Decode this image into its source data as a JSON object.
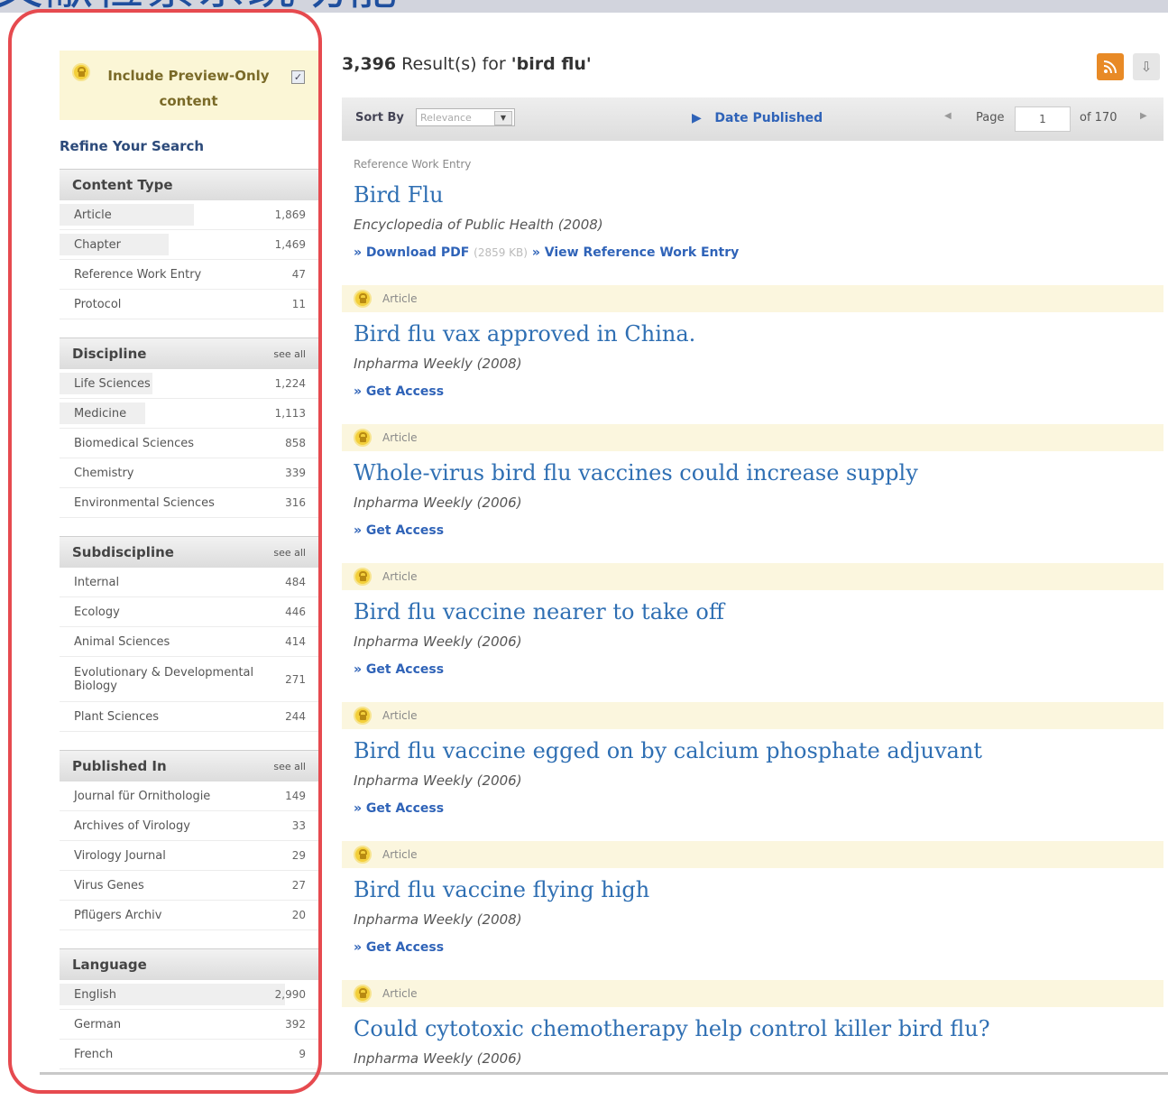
{
  "page_heading": "文献检索系统功能",
  "sidebar": {
    "preview_label": "Include Preview-Only content",
    "preview_checked": true,
    "refine_title": "Refine Your Search",
    "facets": [
      {
        "title": "Content Type",
        "see_all": "",
        "items": [
          {
            "label": "Article",
            "count": "1,869",
            "share": 0.52
          },
          {
            "label": "Chapter",
            "count": "1,469",
            "share": 0.42
          },
          {
            "label": "Reference Work Entry",
            "count": "47",
            "share": 0.0
          },
          {
            "label": "Protocol",
            "count": "11",
            "share": 0.0
          }
        ]
      },
      {
        "title": "Discipline",
        "see_all": "see all",
        "items": [
          {
            "label": "Life Sciences",
            "count": "1,224",
            "share": 0.36
          },
          {
            "label": "Medicine",
            "count": "1,113",
            "share": 0.33
          },
          {
            "label": "Biomedical Sciences",
            "count": "858",
            "share": 0.0
          },
          {
            "label": "Chemistry",
            "count": "339",
            "share": 0.0
          },
          {
            "label": "Environmental Sciences",
            "count": "316",
            "share": 0.0
          }
        ]
      },
      {
        "title": "Subdiscipline",
        "see_all": "see all",
        "items": [
          {
            "label": "Internal",
            "count": "484",
            "share": 0.0
          },
          {
            "label": "Ecology",
            "count": "446",
            "share": 0.0
          },
          {
            "label": "Animal Sciences",
            "count": "414",
            "share": 0.0
          },
          {
            "label": "Evolutionary & Developmental Biology",
            "count": "271",
            "share": 0.0,
            "tall": true
          },
          {
            "label": "Plant Sciences",
            "count": "244",
            "share": 0.0
          }
        ]
      },
      {
        "title": "Published In",
        "see_all": "see all",
        "items": [
          {
            "label": "Journal für Ornithologie",
            "count": "149",
            "share": 0.0
          },
          {
            "label": "Archives of Virology",
            "count": "33",
            "share": 0.0
          },
          {
            "label": "Virology Journal",
            "count": "29",
            "share": 0.0
          },
          {
            "label": "Virus Genes",
            "count": "27",
            "share": 0.0
          },
          {
            "label": "Pflügers Archiv",
            "count": "20",
            "share": 0.0
          }
        ]
      },
      {
        "title": "Language",
        "see_all": "",
        "items": [
          {
            "label": "English",
            "count": "2,990",
            "share": 0.87
          },
          {
            "label": "German",
            "count": "392",
            "share": 0.0
          },
          {
            "label": "French",
            "count": "9",
            "share": 0.0
          }
        ]
      }
    ]
  },
  "results_header": {
    "count": "3,396",
    "text_before_query": " Result(s) for ",
    "query": "'bird flu'",
    "rss_icon": "rss-icon",
    "download_icon": "download-icon"
  },
  "toolbar": {
    "sort_by_label": "Sort By",
    "sort_value": "Relevance",
    "date_published": "Date Published",
    "page_label": "Page",
    "page_value": "1",
    "page_of": "of 170",
    "prev_icon": "◀",
    "next_icon": "▶"
  },
  "results": [
    {
      "type": "Reference Work Entry",
      "locked": false,
      "title": "Bird Flu",
      "source": "Encyclopedia of Public Health (2008)",
      "link1": "» Download PDF",
      "size": "(2859 KB)",
      "link2": "» View Reference Work Entry"
    },
    {
      "type": "Article",
      "locked": true,
      "title": "Bird flu vax approved in China.",
      "source": "Inpharma Weekly (2008)",
      "link1": "» Get Access"
    },
    {
      "type": "Article",
      "locked": true,
      "title": "Whole-virus bird flu vaccines could increase supply",
      "source": "Inpharma Weekly (2006)",
      "link1": "» Get Access"
    },
    {
      "type": "Article",
      "locked": true,
      "title": "Bird flu vaccine nearer to take off",
      "source": "Inpharma Weekly (2006)",
      "link1": "» Get Access"
    },
    {
      "type": "Article",
      "locked": true,
      "title": "Bird flu vaccine egged on by calcium phosphate adjuvant",
      "source": "Inpharma Weekly (2006)",
      "link1": "» Get Access"
    },
    {
      "type": "Article",
      "locked": true,
      "title": "Bird flu vaccine flying high",
      "source": "Inpharma Weekly (2008)",
      "link1": "» Get Access"
    },
    {
      "type": "Article",
      "locked": true,
      "title": "Could cytotoxic chemotherapy help control killer bird flu?",
      "source": "Inpharma Weekly (2006)",
      "link1": ""
    }
  ],
  "colors": {
    "link": "#2f63b8",
    "title": "#2f6fb3",
    "highlight": "#e64a4f",
    "preview_bg": "#fbf6d6",
    "rss": "#e88a26"
  }
}
